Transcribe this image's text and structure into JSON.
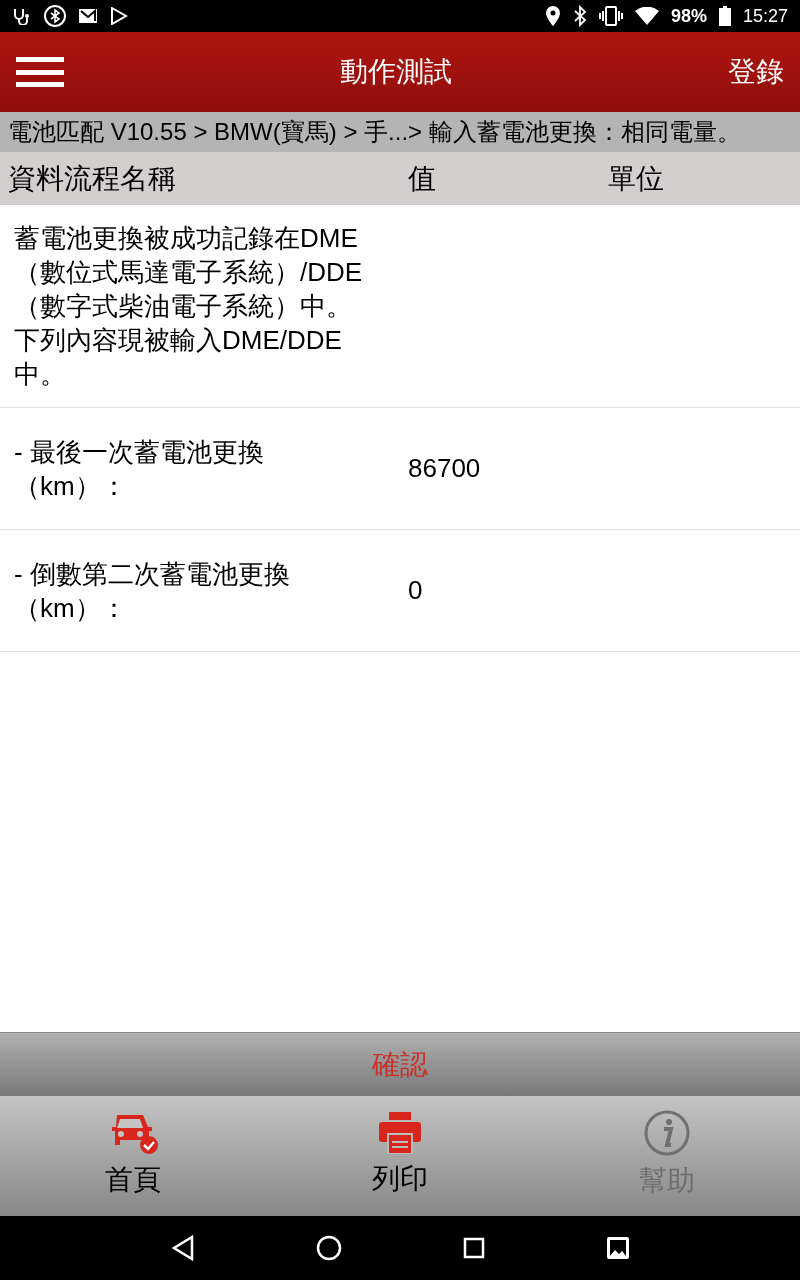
{
  "status_bar": {
    "battery": "98%",
    "time": "15:27"
  },
  "header": {
    "title": "動作測試",
    "action": "登錄"
  },
  "breadcrumb": "電池匹配 V10.55 > BMW(寶馬) > 手...> 輸入蓄電池更換：相同電量。",
  "table": {
    "columns": [
      "資料流程名稱",
      "值",
      "單位"
    ],
    "rows": [
      {
        "paragraphs": [
          "蓄電池更換被成功記錄在DME（數位式馬達電子系統）/DDE（數字式柴油電子系統）中。",
          "下列內容現被輸入DME/DDE中。"
        ]
      },
      {
        "name": "- 最後一次蓄電池更換（km）：",
        "value": "86700"
      },
      {
        "name": "- 倒數第二次蓄電池更換（km）：",
        "value": "0"
      }
    ]
  },
  "confirm_button": "確認",
  "bottom_tabs": [
    {
      "kind": "home",
      "label": "首頁",
      "disabled": false
    },
    {
      "kind": "print",
      "label": "列印",
      "disabled": false
    },
    {
      "kind": "help",
      "label": "幫助",
      "disabled": true
    }
  ]
}
